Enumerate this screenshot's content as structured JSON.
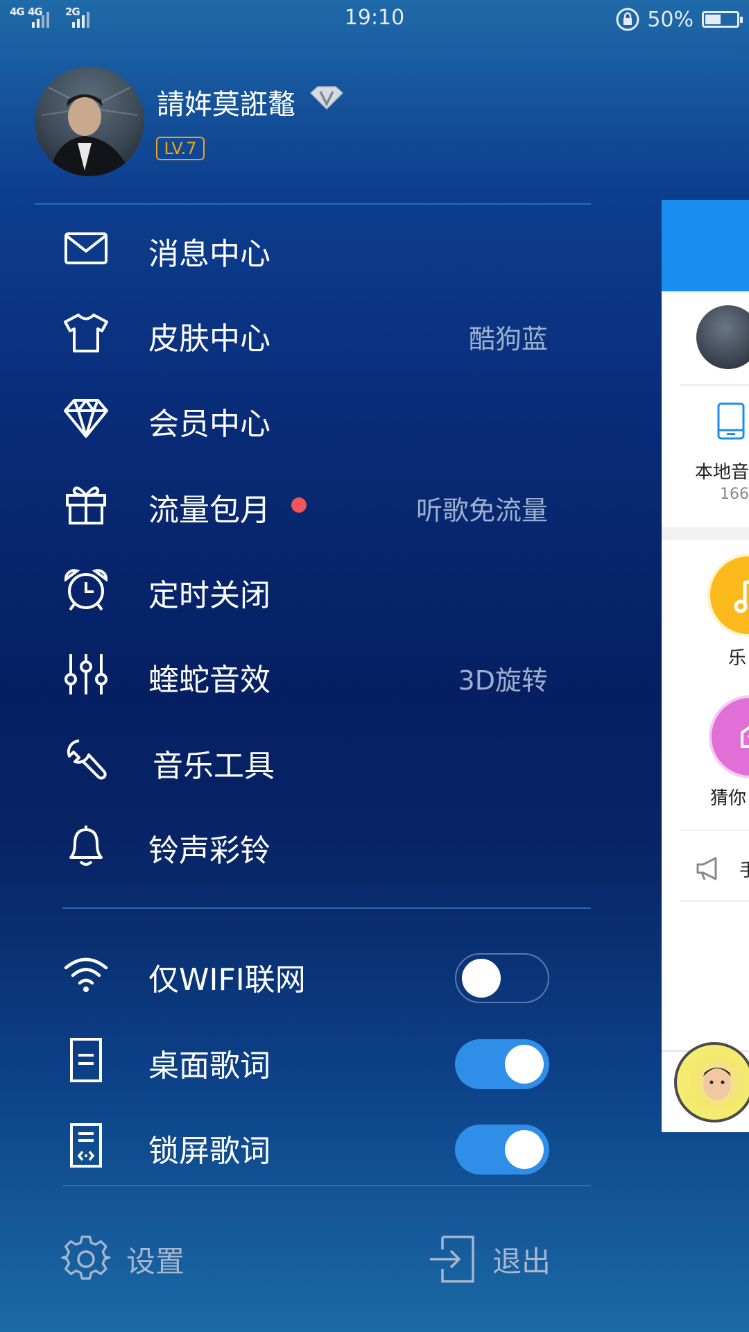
{
  "status_bar": {
    "signal_1": "4G",
    "signal_2": "4G",
    "signal_3": "2G",
    "time": "19:10",
    "battery_percent": "50%",
    "battery_level": 0.5
  },
  "profile": {
    "username": "請姩莫誑鼇",
    "level": "LV.7",
    "vip_icon": "diamond-v-icon"
  },
  "menu": [
    {
      "label": "消息中心",
      "value": "",
      "icon": "mail-icon"
    },
    {
      "label": "皮肤中心",
      "value": "酷狗蓝",
      "icon": "tshirt-icon"
    },
    {
      "label": "会员中心",
      "value": "",
      "icon": "diamond-icon"
    },
    {
      "label": "流量包月",
      "value": "听歌免流量",
      "icon": "gift-icon",
      "has_dot": true
    },
    {
      "label": "定时关闭",
      "value": "",
      "icon": "alarm-clock-icon"
    },
    {
      "label": "蝰蛇音效",
      "value": "3D旋转",
      "icon": "equalizer-icon"
    },
    {
      "label": "音乐工具",
      "value": "",
      "icon": "wrench-icon"
    },
    {
      "label": "铃声彩铃",
      "value": "",
      "icon": "bell-icon"
    }
  ],
  "toggles": [
    {
      "label": "仅WIFI联网",
      "state": "off",
      "icon": "wifi-icon"
    },
    {
      "label": "桌面歌词",
      "state": "on",
      "icon": "lyrics-doc-icon"
    },
    {
      "label": "锁屏歌词",
      "state": "on",
      "icon": "lock-lyrics-icon"
    }
  ],
  "footer": {
    "settings_label": "设置",
    "logout_label": "退出"
  },
  "peek_panel": {
    "local_music_label": "本地音",
    "local_music_count": "166",
    "item_1_label": "乐",
    "item_2_label": "猜你",
    "notice_text": "手",
    "colors": {
      "header": "#1a8df0",
      "circle_yellow": "#fbb91b",
      "circle_pink": "#e070d8"
    }
  }
}
